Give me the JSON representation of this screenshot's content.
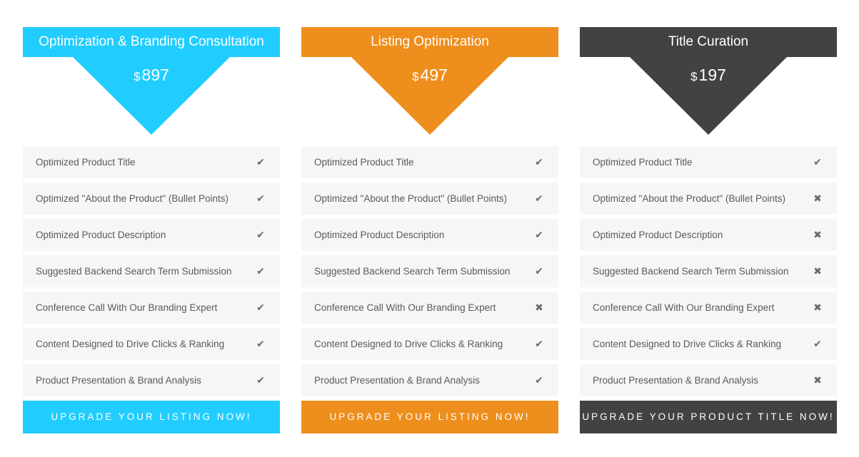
{
  "plans": [
    {
      "title": "Optimization & Branding Consultation",
      "currency": "$",
      "price": "897",
      "color": "#21cdfe",
      "button_label": "UPGRADE YOUR LISTING NOW!",
      "features": [
        {
          "label": "Optimized Product Title",
          "included": true,
          "icon": "check-icon"
        },
        {
          "label": "Optimized \"About the Product\" (Bullet Points)",
          "included": true,
          "icon": "check-icon"
        },
        {
          "label": "Optimized Product Description",
          "included": true,
          "icon": "check-icon"
        },
        {
          "label": "Suggested Backend Search Term Submission",
          "included": true,
          "icon": "check-icon"
        },
        {
          "label": "Conference Call With Our Branding Expert",
          "included": true,
          "icon": "check-icon"
        },
        {
          "label": "Content Designed to Drive Clicks & Ranking",
          "included": true,
          "icon": "check-icon"
        },
        {
          "label": "Product Presentation & Brand Analysis",
          "included": true,
          "icon": "check-icon"
        }
      ]
    },
    {
      "title": "Listing Optimization",
      "currency": "$",
      "price": "497",
      "color": "#ee8e1c",
      "button_label": "UPGRADE YOUR LISTING NOW!",
      "features": [
        {
          "label": "Optimized Product Title",
          "included": true,
          "icon": "check-icon"
        },
        {
          "label": "Optimized \"About the Product\" (Bullet Points)",
          "included": true,
          "icon": "check-icon"
        },
        {
          "label": "Optimized Product Description",
          "included": true,
          "icon": "check-icon"
        },
        {
          "label": "Suggested Backend Search Term Submission",
          "included": true,
          "icon": "check-icon"
        },
        {
          "label": "Conference Call With Our Branding Expert",
          "included": false,
          "icon": "cross-icon"
        },
        {
          "label": "Content Designed to Drive Clicks & Ranking",
          "included": true,
          "icon": "check-icon"
        },
        {
          "label": "Product Presentation & Brand Analysis",
          "included": true,
          "icon": "check-icon"
        }
      ]
    },
    {
      "title": "Title Curation",
      "currency": "$",
      "price": "197",
      "color": "#424242",
      "button_label": "UPGRADE YOUR PRODUCT TITLE NOW!",
      "features": [
        {
          "label": "Optimized Product Title",
          "included": true,
          "icon": "check-icon"
        },
        {
          "label": "Optimized \"About the Product\" (Bullet Points)",
          "included": false,
          "icon": "cross-icon"
        },
        {
          "label": "Optimized Product Description",
          "included": false,
          "icon": "cross-icon"
        },
        {
          "label": "Suggested Backend Search Term Submission",
          "included": false,
          "icon": "cross-icon"
        },
        {
          "label": "Conference Call With Our Branding Expert",
          "included": false,
          "icon": "cross-icon"
        },
        {
          "label": "Content Designed to Drive Clicks & Ranking",
          "included": true,
          "icon": "check-icon"
        },
        {
          "label": "Product Presentation & Brand Analysis",
          "included": false,
          "icon": "cross-icon"
        }
      ]
    }
  ]
}
